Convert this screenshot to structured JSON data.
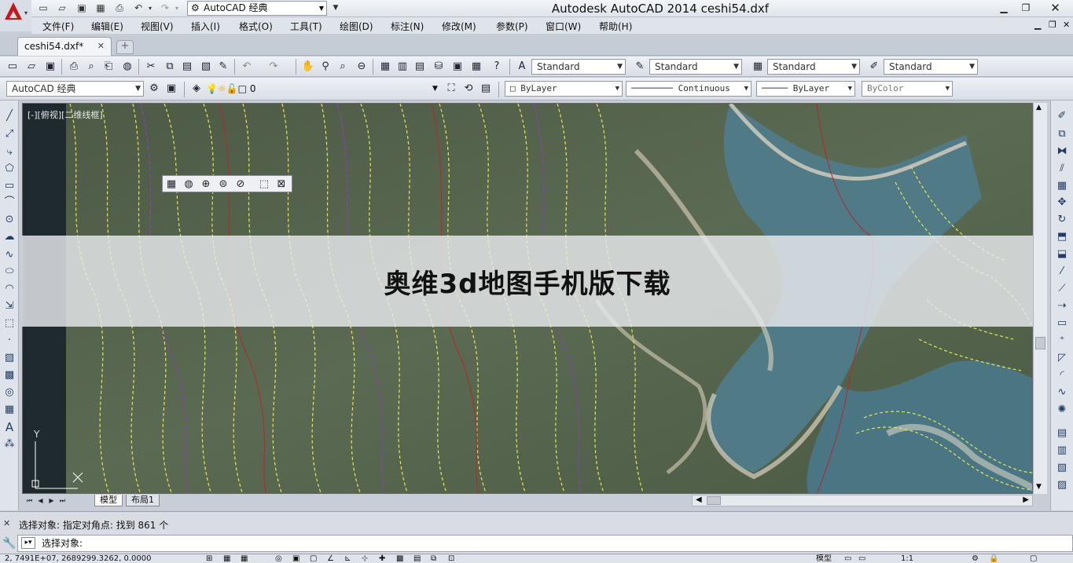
{
  "title_bar": {
    "window_title": "Autodesk AutoCAD 2014    ceshi54.dxf",
    "workspace": "AutoCAD 经典",
    "quick_access": [
      "new-icon",
      "open-icon",
      "save-icon",
      "saveas-icon",
      "plot-icon",
      "undo-icon",
      "redo-icon"
    ]
  },
  "menu": {
    "items": [
      "文件(F)",
      "编辑(E)",
      "视图(V)",
      "插入(I)",
      "格式(O)",
      "工具(T)",
      "绘图(D)",
      "标注(N)",
      "修改(M)",
      "参数(P)",
      "窗口(W)",
      "帮助(H)"
    ]
  },
  "tabs": {
    "document": "ceshi54.dxf*",
    "new_tab": "+"
  },
  "styles_toolbar": {
    "text_style": "Standard",
    "dim_style": "Standard",
    "table_style": "Standard",
    "mleader_style": "Standard"
  },
  "layers_toolbar": {
    "workspace": "AutoCAD 经典",
    "layer": "0",
    "color": "ByLayer",
    "linetype": "Continuous",
    "lineweight": "ByLayer",
    "plotstyle": "ByColor"
  },
  "viewport": {
    "label": "[-][俯视][二维线框]",
    "ucs_y": "Y"
  },
  "banner": {
    "text": "奥维3d地图手机版下载"
  },
  "layout_tabs": {
    "model": "模型",
    "layout1": "布局1"
  },
  "command": {
    "history": "选择对象: 指定对角点: 找到 861 个",
    "prompt": "选择对象:"
  },
  "status": {
    "coords": "2, 7491E+07,  2689299.3262, 0.0000",
    "model": "模型",
    "scale": "1:1"
  },
  "colors": {
    "menu_bg": "#dfe3ea",
    "logo_red": "#c8161d",
    "contour_yellow": "#e8e84a",
    "contour_purple": "#8a3fb8",
    "contour_red": "#b8262a",
    "water": "#4f7a86"
  }
}
